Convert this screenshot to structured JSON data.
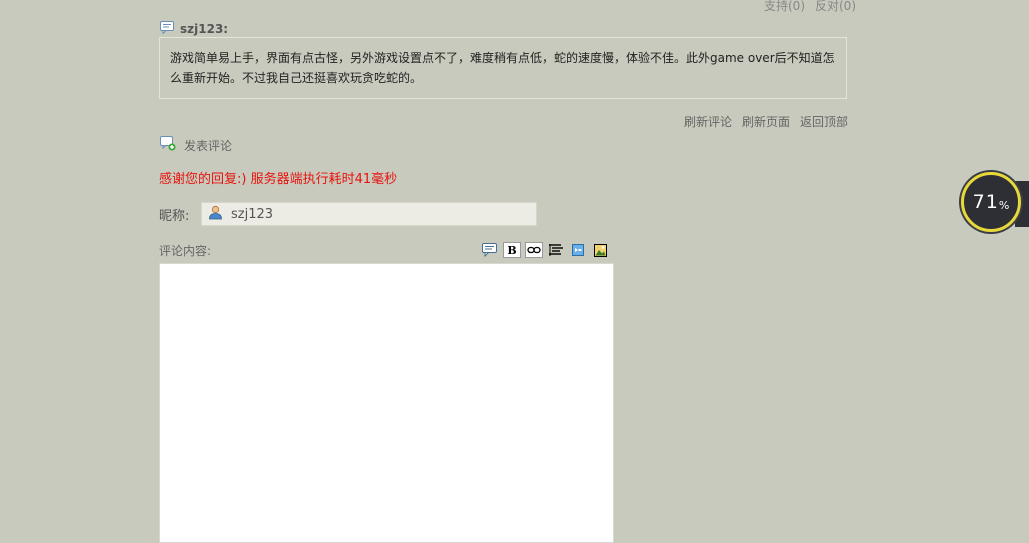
{
  "votes": {
    "support": "支持(0)",
    "oppose": "反对(0)"
  },
  "comment": {
    "author": "szj123:",
    "text": "游戏简单易上手，界面有点古怪，另外游戏设置点不了，难度稍有点低，蛇的速度慢，体验不佳。此外game over后不知道怎么重新开始。不过我自己还挺喜欢玩贪吃蛇的。"
  },
  "links": {
    "refresh_comments": "刷新评论",
    "refresh_page": "刷新页面",
    "back_top": "返回顶部"
  },
  "post": {
    "title": "发表评论",
    "thanks": "感谢您的回复:) 服务器端执行耗时41毫秒",
    "nickname_label": "昵称:",
    "nickname_value": "szj123",
    "content_label": "评论内容:",
    "bold_label": "B"
  },
  "widget": {
    "value": "71",
    "unit": "%"
  },
  "icons": [
    "comment-bubble-icon",
    "comment-add-icon",
    "user-icon",
    "quote-icon",
    "bold-icon",
    "link-icon",
    "code-icon",
    "emoticon-icon",
    "image-icon"
  ],
  "colors": {
    "background": "#c7cabc",
    "thanks": "#e8130f",
    "ring": "#e8d93a"
  }
}
